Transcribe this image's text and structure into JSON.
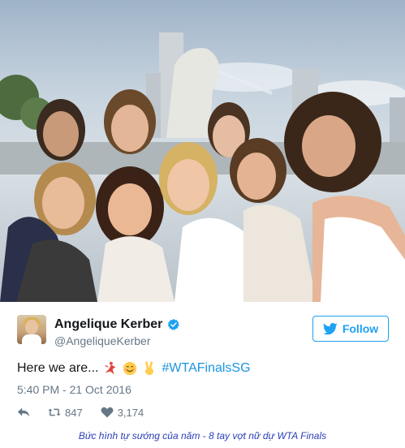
{
  "tweet": {
    "photo_alt": "group-selfie-photo",
    "author": {
      "display_name": "Angelique Kerber",
      "handle": "@AngeliqueKerber",
      "verified": true
    },
    "follow_label": "Follow",
    "text_prefix": "Here we are...",
    "emojis": [
      "dancer-emoji",
      "smiling-face-emoji",
      "victory-hand-emoji"
    ],
    "hashtag": "#WTAFinalsSG",
    "timestamp": "5:40 PM - 21 Oct 2016",
    "retweets": "847",
    "likes": "3,174"
  },
  "caption": "Bức hình tự sướng của năm - 8 tay vợt nữ dự WTA Finals",
  "colors": {
    "twitter_blue": "#1da1f2",
    "hashtag_blue": "#1b95e0",
    "secondary_text": "#657786",
    "caption_blue": "#2a3fb8"
  }
}
